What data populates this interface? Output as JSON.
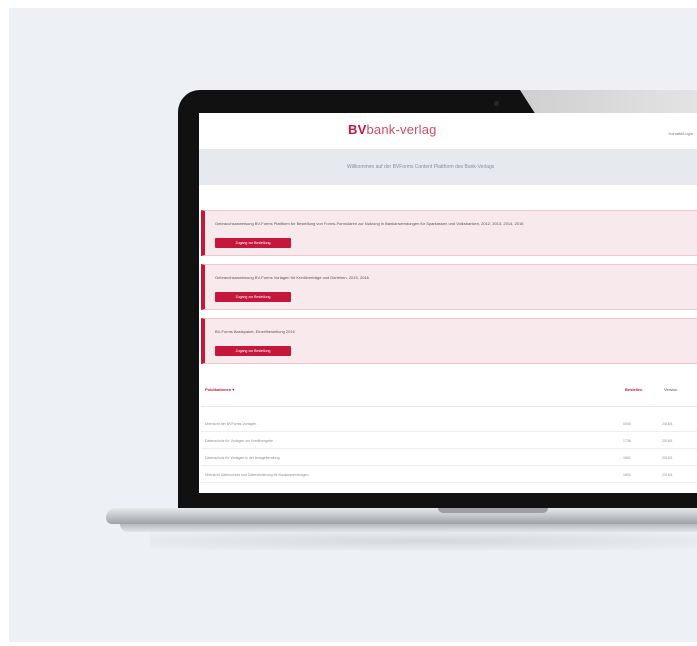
{
  "site": {
    "logo_mark": "BV",
    "logo_word": "bank-verlag",
    "top_right_link": "Kontakt/Login",
    "welcome": "Willkommen auf der BVForms Content Plattform des Bank-Verlags"
  },
  "cards": [
    {
      "text": "Gebrauchsanweisung BV-Forms Plattform für Bestellung von Forms-Formularen zur Nutzung in Bankanwendungen für Sparkassen und Volksbanken, 2012, 2013, 2014, 2015",
      "button": "Zugang zur Bestellung"
    },
    {
      "text": "Gebrauchsanweisung BV-Forms Vorlagen für Kreditverträge und Darlehen, 2015, 2016",
      "button": "Zugang zur Bestellung"
    },
    {
      "text": "BV-Forms Basispaket, Einzelbestellung 2016",
      "button": "Zugang zur Bestellung"
    }
  ],
  "table": {
    "header": {
      "title": "Publikationen ▾",
      "col2": "Bestellnr.",
      "col3": "Version"
    },
    "rows": [
      {
        "title": "Übersicht der BVForms-Vorlagen",
        "col2": "0000",
        "col3": "2016/1"
      },
      {
        "title": "Datenschutz für Vorlagen zur Kreditvergabe",
        "col2": "1736",
        "col3": "2016/1"
      },
      {
        "title": "Datenschutz für Vorlagen in der Anlageberatung",
        "col2": "1801",
        "col3": "2016/1"
      },
      {
        "title": "Übersicht Datenschutz und Datensicherung für Bankanwendungen",
        "col2": "1801",
        "col3": "2016/1"
      }
    ]
  },
  "colors": {
    "accent": "#c4173b",
    "band": "#e6e9ee",
    "card_bg": "#f8e9ec"
  }
}
